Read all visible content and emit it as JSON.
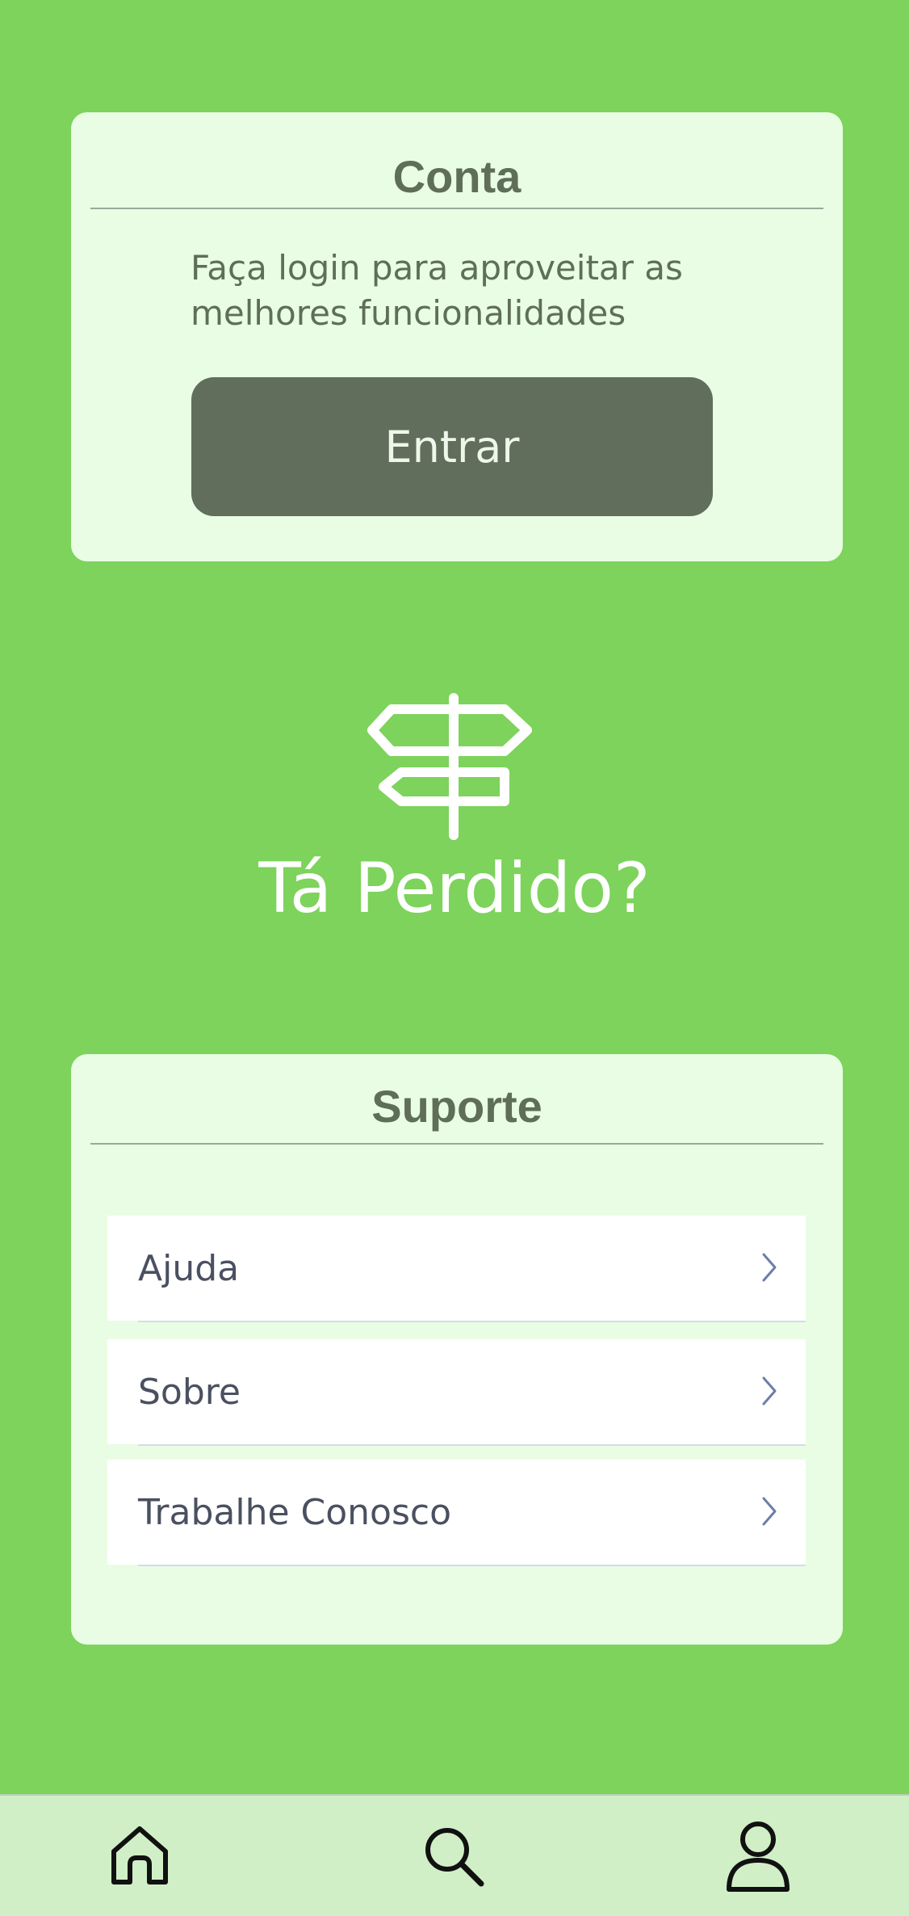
{
  "account": {
    "title": "Conta",
    "description": "Faça login para aproveitar as melhores funcionalidades",
    "login_button": "Entrar"
  },
  "lost": {
    "icon": "signpost-icon",
    "title": "Tá Perdido?"
  },
  "support": {
    "title": "Suporte",
    "items": [
      {
        "label": "Ajuda",
        "icon": "chevron-right-icon"
      },
      {
        "label": "Sobre",
        "icon": "chevron-right-icon"
      },
      {
        "label": "Trabalhe Conosco",
        "icon": "chevron-right-icon"
      }
    ]
  },
  "bottom_nav": {
    "items": [
      {
        "icon": "home-icon"
      },
      {
        "icon": "search-icon"
      },
      {
        "icon": "profile-icon"
      }
    ]
  },
  "colors": {
    "background": "#7dd35b",
    "card": "#e9fde4",
    "button": "#616e5b",
    "nav": "#d0efc6"
  }
}
